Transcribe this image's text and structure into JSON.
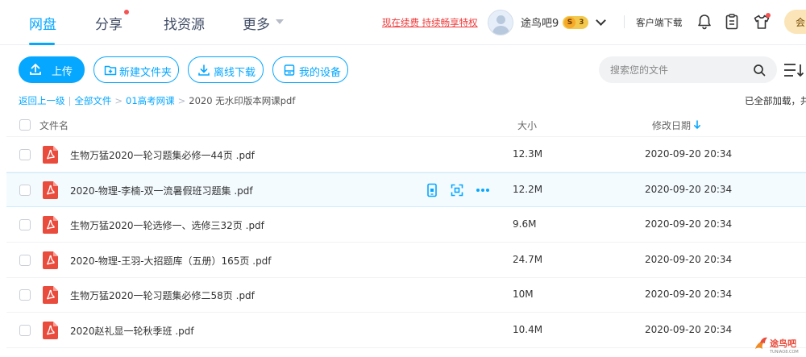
{
  "nav": {
    "tabs": [
      "网盘",
      "分享",
      "找资源",
      "更多"
    ],
    "promo": "现在续费 持续畅享特权",
    "username": "途鸟吧9",
    "vip_level": "3",
    "vip_letter": "S",
    "client_download": "客户端下载",
    "right_pill": "会"
  },
  "toolbar": {
    "upload": "上传",
    "new_folder": "新建文件夹",
    "offline_download": "离线下载",
    "my_devices": "我的设备",
    "search_placeholder": "搜索您的文件"
  },
  "breadcrumb": {
    "back": "返回上一级",
    "all_files": "全部文件",
    "folder": "01高考网课",
    "current": "2020 无水印版本网课pdf",
    "sep": ">",
    "divider": "|"
  },
  "status": "已全部加载，共",
  "table": {
    "col_name": "文件名",
    "col_size": "大小",
    "col_date": "修改日期",
    "rows": [
      {
        "name": "生物万猛2020一轮习题集必修一44页 .pdf",
        "size": "12.3M",
        "date": "2020-09-20 20:34"
      },
      {
        "name": "2020-物理-李楠-双一流暑假班习题集 .pdf",
        "size": "12.2M",
        "date": "2020-09-20 20:34"
      },
      {
        "name": "生物万猛2020一轮选修一、选修三32页 .pdf",
        "size": "9.6M",
        "date": "2020-09-20 20:34"
      },
      {
        "name": "2020-物理-王羽-大招题库（五册）165页 .pdf",
        "size": "24.7M",
        "date": "2020-09-20 20:34"
      },
      {
        "name": "生物万猛2020一轮习题集必修二58页 .pdf",
        "size": "10M",
        "date": "2020-09-20 20:34"
      },
      {
        "name": "2020赵礼显一轮秋季班 .pdf",
        "size": "10.4M",
        "date": "2020-09-20 20:34"
      }
    ]
  },
  "watermark": {
    "text": "途鸟吧",
    "sub": "TUNIAO8.COM"
  },
  "colors": {
    "accent": "#06a7ff",
    "pdf_red": "#e94b3c",
    "promo_red": "#ee3b3b"
  }
}
